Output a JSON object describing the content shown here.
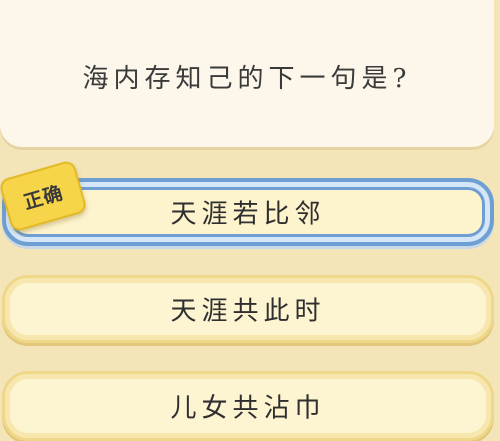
{
  "question": {
    "text": "海内存知己的下一句是?"
  },
  "options": [
    {
      "label": "天涯若比邻",
      "selected": true
    },
    {
      "label": "天涯共此时",
      "selected": false
    },
    {
      "label": "儿女共沾巾",
      "selected": false
    }
  ],
  "badge": {
    "text": "正确",
    "color": "#f6d54a"
  },
  "colors": {
    "selected_border": "#6e9fd2",
    "option_border": "#efd78a",
    "background": "#f3e5b8"
  }
}
